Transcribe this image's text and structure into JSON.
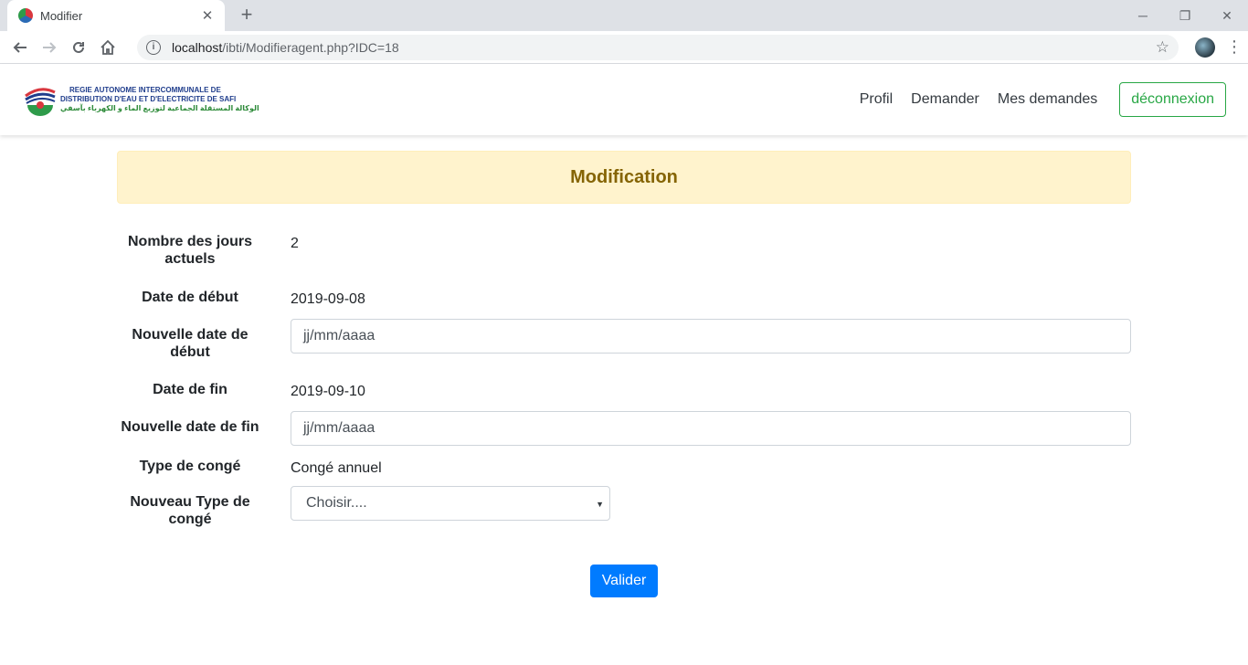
{
  "browser": {
    "tab_title": "Modifier",
    "tab_close": "✕",
    "new_tab": "+",
    "url_host": "localhost",
    "url_path": "/ibti/Modifieragent.php?IDC=18",
    "win_min": "─",
    "win_restore": "❐",
    "win_close": "✕"
  },
  "site": {
    "logo": {
      "line1": "REGIE AUTONOME INTERCOMMUNALE DE",
      "line2": "DISTRIBUTION D'EAU ET D'ELECTRICITE DE SAFI",
      "line3": "الوكالة المستقلة الجماعية لتوزيع الماء و الكهرباء بآسفي"
    },
    "nav": {
      "profil": "Profil",
      "demander": "Demander",
      "mes_demandes": "Mes demandes",
      "logout": "déconnexion"
    }
  },
  "page": {
    "title": "Modification",
    "fields": {
      "jours_label": "Nombre des jours actuels",
      "jours_value": "2",
      "date_debut_label": "Date de début",
      "date_debut_value": "2019-09-08",
      "nouvelle_date_debut_label": "Nouvelle date de début",
      "nouvelle_date_debut_placeholder": "jj/mm/aaaa",
      "date_fin_label": "Date de fin",
      "date_fin_value": "2019-09-10",
      "nouvelle_date_fin_label": "Nouvelle date de fin",
      "nouvelle_date_fin_placeholder": "jj/mm/aaaa",
      "type_label": "Type de congé",
      "type_value": "Congé annuel",
      "nouveau_type_label": "Nouveau Type de congé",
      "nouveau_type_selected": "Choisir...."
    },
    "submit": "Valider"
  },
  "colors": {
    "alert_bg": "#fff3cd",
    "alert_text": "#856404",
    "primary": "#007bff",
    "success": "#28a745"
  }
}
